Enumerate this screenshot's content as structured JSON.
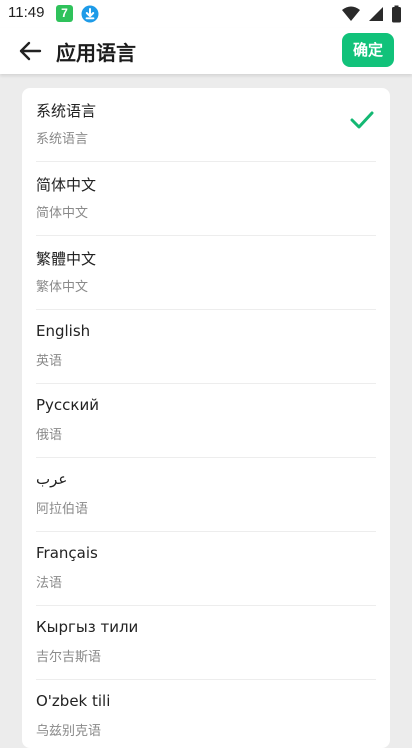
{
  "status_bar": {
    "time": "11:49",
    "app_badge": "7"
  },
  "header": {
    "title": "应用语言",
    "confirm_label": "确定"
  },
  "colors": {
    "accent": "#11c27a",
    "check": "#14b873"
  },
  "languages": [
    {
      "name": "系统语言",
      "subtitle": "系统语言",
      "selected": true
    },
    {
      "name": "简体中文",
      "subtitle": "简体中文",
      "selected": false
    },
    {
      "name": "繁體中文",
      "subtitle": "繁体中文",
      "selected": false
    },
    {
      "name": "English",
      "subtitle": "英语",
      "selected": false
    },
    {
      "name": "Русский",
      "subtitle": "俄语",
      "selected": false
    },
    {
      "name": "عرب",
      "subtitle": "阿拉伯语",
      "selected": false
    },
    {
      "name": "Français",
      "subtitle": "法语",
      "selected": false
    },
    {
      "name": "Кыргыз тили",
      "subtitle": "吉尔吉斯语",
      "selected": false
    },
    {
      "name": "O'zbek tili",
      "subtitle": "乌兹别克语",
      "selected": false
    }
  ]
}
